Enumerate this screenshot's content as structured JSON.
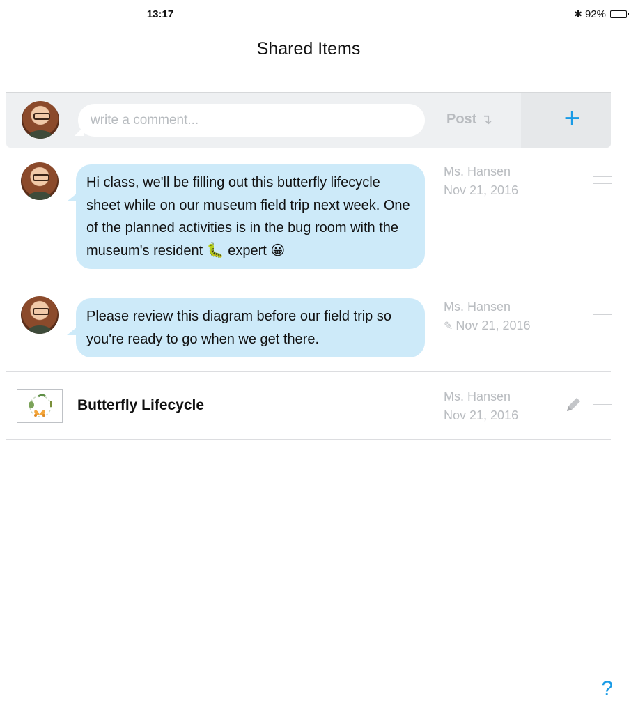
{
  "status_bar": {
    "time": "13:17",
    "bluetooth_icon": "bluetooth-icon",
    "battery_text": "92%",
    "battery_level": 0.92
  },
  "header": {
    "title": "Shared Items"
  },
  "composer": {
    "placeholder": "write a comment...",
    "post_label": "Post",
    "post_arrow": "↴",
    "add_label": "+",
    "add_icon": "plus-icon"
  },
  "messages": [
    {
      "text": "Hi class, we'll be filling out this butterfly lifecycle sheet while on our museum field trip next week. One of the planned activities is in the bug room with the museum's resident 🐛 expert 😀",
      "author": "Ms. Hansen",
      "date": "Nov 21, 2016",
      "edited": false
    },
    {
      "text": "Please review this diagram before our field trip so you're ready to go when we get there.",
      "author": "Ms. Hansen",
      "date": "Nov 21, 2016",
      "edited": true
    }
  ],
  "file": {
    "name": "Butterfly Lifecycle",
    "author": "Ms. Hansen",
    "date": "Nov 21, 2016"
  },
  "help_label": "?",
  "colors": {
    "accent": "#1a9be6",
    "bubble": "#cdeaf9",
    "meta_text": "#b9bcc0",
    "composer_bg": "#eef0f2"
  }
}
